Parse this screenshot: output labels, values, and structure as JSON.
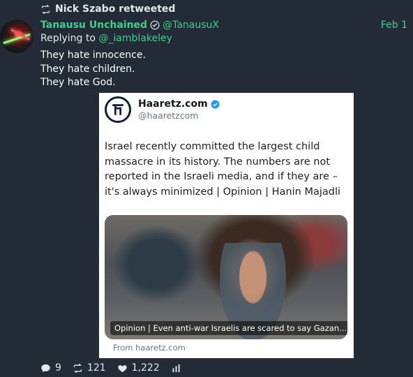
{
  "retweet": {
    "label": "Nick Szabo retweeted"
  },
  "tweet": {
    "author_name": "Tanausu Unchained",
    "handle": "@TanausuX",
    "date": "Feb 1",
    "replying_prefix": "Replying to ",
    "replying_to": "@_iamblakeley",
    "text_lines": [
      "They hate innocence.",
      "They hate children.",
      "They hate God."
    ]
  },
  "embed": {
    "source_name": "Haaretz.com",
    "source_handle": "@haaretzcom",
    "headline": "Israel recently committed the largest child massacre in its history. The numbers are not reported in the Israeli media, and if they are – it's always minimized | Opinion | Hanin Majadli",
    "photo_caption": "Opinion | Even anti-war Israelis are scared to say Gazan...",
    "from_text": "From haaretz.com"
  },
  "actions": {
    "replies": "9",
    "retweets": "121",
    "likes": "1,222"
  },
  "colors": {
    "background": "#222b36",
    "accent": "#3fcf8e",
    "verified_badge": "#1d9bf0"
  }
}
